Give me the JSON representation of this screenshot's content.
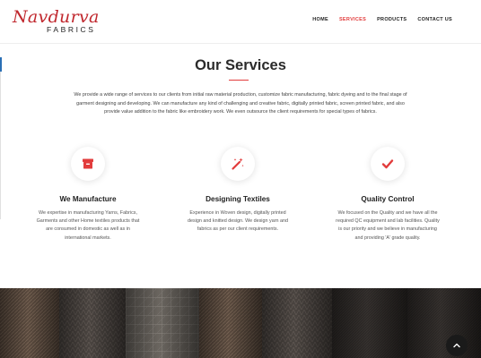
{
  "header": {
    "logo_script": "Navdurva",
    "logo_sub": "FABRICS",
    "nav": [
      {
        "label": "HOME",
        "active": false
      },
      {
        "label": "SERVICES",
        "active": true
      },
      {
        "label": "PRODUCTS",
        "active": false
      },
      {
        "label": "CONTACT US",
        "active": false
      }
    ]
  },
  "services_section": {
    "title": "Our Services",
    "intro": "We provide a wide range of services to our clients from initial raw material production, customize fabric manufacturing, fabric dyeing and to the final stage of garment designing and developing. We can manufacture any kind of challenging and creative fabric, digitally printed fabric, screen printed fabric, and also provide value addition to the fabric like embroidery work. We even outsource the client requirements for special types of fabrics.",
    "items": [
      {
        "icon": "archive-box-icon",
        "title": "We Manufacture",
        "text": "We expertise in manufacturing Yarns, Fabrics, Garments and other Home textiles products that are consumed in domestic as well as in international markets."
      },
      {
        "icon": "magic-wand-icon",
        "title": "Designing Textiles",
        "text": "Experience in Woven design, digitally printed design and knitted design. We design yarn and fabrics as per our client requirements."
      },
      {
        "icon": "checkmark-icon",
        "title": "Quality Control",
        "text": "We focused on the Quality and we have all the required QC equipment and lab facilities. Quality is our priority and we believe in manufacturing and providing 'A' grade quality."
      }
    ]
  },
  "colors": {
    "accent": "#e23c3c",
    "logo_red": "#c0272d",
    "text_dark": "#222222"
  }
}
